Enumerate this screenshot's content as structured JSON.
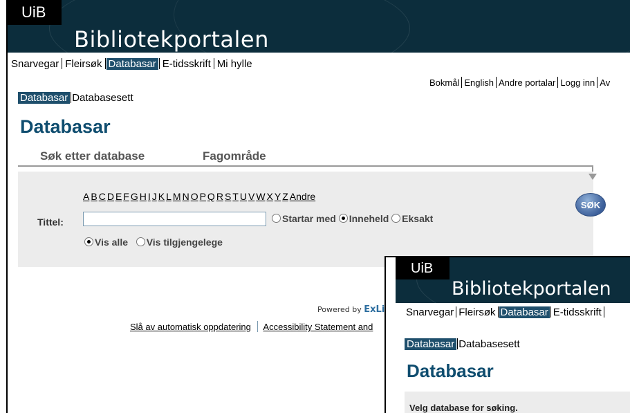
{
  "header": {
    "badge": "UiB",
    "title": "Bibliotekportalen"
  },
  "topnav": [
    "Snarvegar",
    "Fleirsøk",
    "Databasar",
    "E-tidsskrift",
    "Mi hylle"
  ],
  "langnav": [
    "Bokmål",
    "English",
    "Andre portalar",
    "Logg inn",
    "Av"
  ],
  "subnav": {
    "active": "Databasar",
    "other": "Databasesett"
  },
  "page_title": "Databasar",
  "tabs": [
    "Søk etter database",
    "Fagområde"
  ],
  "search": {
    "alphabet": [
      "A",
      "B",
      "C",
      "D",
      "E",
      "F",
      "G",
      "H",
      "I",
      "J",
      "K",
      "L",
      "M",
      "N",
      "O",
      "P",
      "Q",
      "R",
      "S",
      "T",
      "U",
      "V",
      "W",
      "X",
      "Y",
      "Z",
      "Andre"
    ],
    "field_label": "Tittel:",
    "input_value": "",
    "match_options": [
      "Startar med",
      "Inneheld",
      "Eksakt"
    ],
    "match_selected": "Inneheld",
    "visibility_options": [
      "Vis alle",
      "Vis tilgjengelege"
    ],
    "visibility_selected": "Vis alle",
    "button_label": "SØK"
  },
  "footer": {
    "powered_by": "Powered by",
    "brand": "ExLib",
    "links": [
      "Slå av automatisk oppdatering",
      "Accessibility Statement and"
    ]
  },
  "overlay": {
    "badge": "UiB",
    "title": "Bibliotekportalen",
    "nav": [
      "Snarvegar",
      "Fleirsøk",
      "Databasar",
      "E-tidsskrift"
    ],
    "subnav": {
      "active": "Databasar",
      "other": "Databasesett"
    },
    "page_title": "Databasar",
    "panel_text": "Velg database for søking."
  },
  "colors": {
    "header_bg": "#0c2d3c",
    "accent": "#1f4f6c",
    "title": "#0f4d6f",
    "panel_bg": "#ececec"
  }
}
